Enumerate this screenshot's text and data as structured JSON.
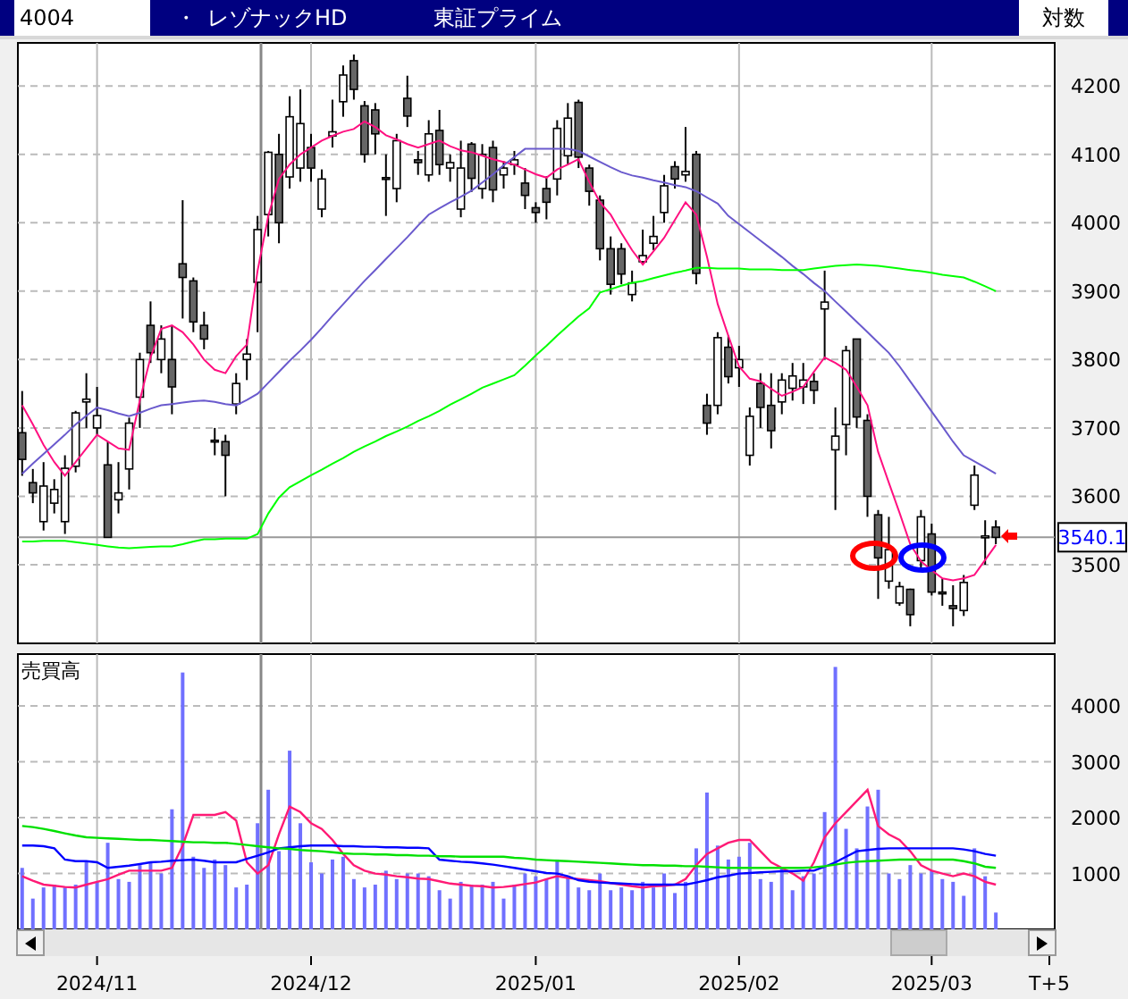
{
  "header": {
    "code": "4004",
    "bullet": "・",
    "name": "レゾナックHD",
    "market": "東証プライム",
    "scale": "対数"
  },
  "price_chart": {
    "markers": [
      {
        "kind": "cursor"
      },
      {
        "kind": "ellipse",
        "color": "#ff0000"
      },
      {
        "kind": "ellipse",
        "color": "#0000ff"
      },
      {
        "kind": "arrow",
        "color": "#ff0000"
      }
    ],
    "chart_data": {
      "type": "candlestick",
      "grid": true,
      "categories": [
        null,
        null,
        null,
        null,
        null,
        null,
        null,
        null,
        null,
        null,
        null,
        null,
        null,
        null,
        null,
        null,
        null,
        null,
        null,
        null,
        null,
        null,
        null,
        null,
        null,
        null,
        null,
        null,
        null,
        null,
        null,
        null,
        null,
        null,
        null,
        null,
        null,
        null,
        null,
        null,
        null,
        null,
        null,
        null,
        null,
        null,
        null,
        null,
        null,
        null,
        null,
        null,
        null,
        null,
        null,
        null,
        null,
        null,
        null,
        null,
        null,
        null,
        null,
        null,
        null,
        null,
        null,
        null,
        null,
        null,
        null,
        null,
        null,
        null,
        null,
        null,
        null,
        null,
        null,
        null,
        null,
        null,
        null,
        null,
        null,
        null,
        null,
        null,
        null,
        null,
        null,
        null,
        null,
        null,
        null,
        null,
        null
      ],
      "ylim": [
        3385,
        4263
      ],
      "yticks": [
        3500,
        3600,
        3700,
        3800,
        3900,
        4000,
        4100,
        4200
      ],
      "ref_lines": [
        {
          "axis": "y",
          "value": 3540.1,
          "label": "3540.1"
        }
      ],
      "ohlc": [
        [
          3693,
          3754,
          3630,
          3654
        ],
        [
          3620,
          3640,
          3590,
          3605
        ],
        [
          3563,
          3650,
          3550,
          3615
        ],
        [
          3590,
          3625,
          3575,
          3610
        ],
        [
          3563,
          3660,
          3545,
          3641
        ],
        [
          3644,
          3725,
          3635,
          3722
        ],
        [
          3738,
          3780,
          3700,
          3742
        ],
        [
          3700,
          3760,
          3690,
          3718
        ],
        [
          3646,
          3680,
          3540,
          3540
        ],
        [
          3595,
          3650,
          3575,
          3605
        ],
        [
          3640,
          3715,
          3610,
          3707
        ],
        [
          3745,
          3810,
          3700,
          3800
        ],
        [
          3850,
          3885,
          3795,
          3810
        ],
        [
          3800,
          3850,
          3780,
          3830
        ],
        [
          3800,
          3850,
          3720,
          3760
        ],
        [
          3940,
          4033,
          3860,
          3920
        ],
        [
          3915,
          3920,
          3840,
          3855
        ],
        [
          3850,
          3870,
          3815,
          3830
        ],
        [
          3682,
          3700,
          3660,
          3680
        ],
        [
          3680,
          3690,
          3600,
          3660
        ],
        [
          3735,
          3780,
          3720,
          3765
        ],
        [
          3800,
          3830,
          3770,
          3808
        ],
        [
          3913,
          4010,
          3840,
          3990
        ],
        [
          4012,
          4105,
          3980,
          4103
        ],
        [
          4100,
          4130,
          3970,
          4000
        ],
        [
          4067,
          4185,
          4050,
          4155
        ],
        [
          4080,
          4195,
          4060,
          4145
        ],
        [
          4110,
          4130,
          4060,
          4080
        ],
        [
          4020,
          4078,
          4008,
          4064
        ],
        [
          4127,
          4180,
          4110,
          4133
        ],
        [
          4177,
          4230,
          4155,
          4216
        ],
        [
          4237,
          4246,
          4180,
          4195
        ],
        [
          4171,
          4178,
          4088,
          4100
        ],
        [
          4165,
          4175,
          4100,
          4130
        ],
        [
          4066,
          4100,
          4010,
          4064
        ],
        [
          4050,
          4130,
          4030,
          4120
        ],
        [
          4182,
          4215,
          4140,
          4156
        ],
        [
          4092,
          4105,
          4070,
          4088
        ],
        [
          4070,
          4150,
          4060,
          4130
        ],
        [
          4135,
          4165,
          4070,
          4085
        ],
        [
          4080,
          4100,
          4060,
          4088
        ],
        [
          4020,
          4120,
          4008,
          4080
        ],
        [
          4115,
          4118,
          4045,
          4065
        ],
        [
          4050,
          4115,
          4035,
          4100
        ],
        [
          4110,
          4120,
          4030,
          4048
        ],
        [
          4070,
          4090,
          4050,
          4080
        ],
        [
          4085,
          4105,
          4070,
          4092
        ],
        [
          4058,
          4080,
          4020,
          4040
        ],
        [
          4022,
          4030,
          4000,
          4015
        ],
        [
          4050,
          4068,
          4005,
          4030
        ],
        [
          4064,
          4150,
          4040,
          4138
        ],
        [
          4098,
          4175,
          4085,
          4153
        ],
        [
          4176,
          4180,
          4080,
          4096
        ],
        [
          4080,
          4085,
          4025,
          4046
        ],
        [
          4033,
          4040,
          3945,
          3962
        ],
        [
          3962,
          3980,
          3895,
          3910
        ],
        [
          3962,
          3970,
          3910,
          3925
        ],
        [
          3895,
          3930,
          3885,
          3912
        ],
        [
          3943,
          3990,
          3940,
          3952
        ],
        [
          3970,
          4010,
          3960,
          3980
        ],
        [
          4015,
          4070,
          4000,
          4054
        ],
        [
          4082,
          4090,
          4050,
          4064
        ],
        [
          4070,
          4140,
          4060,
          4075
        ],
        [
          4100,
          4105,
          3910,
          3926
        ],
        [
          3733,
          3750,
          3690,
          3707
        ],
        [
          3733,
          3840,
          3720,
          3832
        ],
        [
          3818,
          3835,
          3765,
          3775
        ],
        [
          3788,
          3820,
          3760,
          3800
        ],
        [
          3660,
          3730,
          3645,
          3717
        ],
        [
          3765,
          3780,
          3700,
          3730
        ],
        [
          3733,
          3780,
          3670,
          3696
        ],
        [
          3738,
          3780,
          3720,
          3770
        ],
        [
          3758,
          3795,
          3740,
          3776
        ],
        [
          3760,
          3795,
          3735,
          3770
        ],
        [
          3768,
          3780,
          3735,
          3755
        ],
        [
          3874,
          3930,
          3800,
          3884
        ],
        [
          3668,
          3730,
          3580,
          3688
        ],
        [
          3705,
          3820,
          3660,
          3813
        ],
        [
          3830,
          3830,
          3700,
          3716
        ],
        [
          3711,
          3720,
          3570,
          3600
        ],
        [
          3573,
          3580,
          3450,
          3510
        ],
        [
          3476,
          3570,
          3465,
          3522
        ],
        [
          3444,
          3475,
          3440,
          3468
        ],
        [
          3464,
          3465,
          3410,
          3427
        ],
        [
          3506,
          3580,
          3495,
          3570
        ],
        [
          3545,
          3560,
          3455,
          3460
        ],
        [
          3460,
          3480,
          3440,
          3458
        ],
        [
          3440,
          3470,
          3410,
          3436
        ],
        [
          3433,
          3485,
          3425,
          3474
        ],
        [
          3587,
          3645,
          3580,
          3631
        ],
        [
          3540,
          3565,
          3500,
          3542
        ],
        [
          3555,
          3565,
          3530,
          3540
        ],
        null,
        null,
        null,
        null,
        null
      ],
      "series": [
        {
          "type": "line",
          "color": "#ff1080",
          "values": [
            3733,
            3705,
            3675,
            3650,
            3630,
            3650,
            3670,
            3690,
            3680,
            3670,
            3668,
            3740,
            3803,
            3845,
            3850,
            3840,
            3822,
            3800,
            3785,
            3780,
            3805,
            3822,
            3930,
            4010,
            4064,
            4085,
            4100,
            4110,
            4120,
            4127,
            4133,
            4137,
            4148,
            4140,
            4128,
            4122,
            4115,
            4110,
            4115,
            4120,
            4112,
            4106,
            4103,
            4098,
            4093,
            4089,
            4085,
            4078,
            4071,
            4066,
            4078,
            4085,
            4093,
            4060,
            4030,
            4012,
            3985,
            3960,
            3939,
            3958,
            3978,
            4004,
            4030,
            4012,
            3950,
            3881,
            3835,
            3790,
            3772,
            3768,
            3757,
            3747,
            3753,
            3760,
            3782,
            3803,
            3795,
            3785,
            3760,
            3733,
            3665,
            3620,
            3576,
            3530,
            3505,
            3492,
            3480,
            3477,
            3480,
            3485,
            3507,
            3529,
            null,
            null,
            null,
            null,
            null
          ]
        },
        {
          "type": "line",
          "color": "#6a5acd",
          "values": [
            3633,
            3648,
            3662,
            3676,
            3690,
            3705,
            3718,
            3730,
            3726,
            3721,
            3717,
            3722,
            3728,
            3733,
            3735,
            3737,
            3739,
            3740,
            3738,
            3735,
            3733,
            3741,
            3750,
            3766,
            3782,
            3798,
            3813,
            3829,
            3846,
            3864,
            3881,
            3898,
            3915,
            3931,
            3947,
            3963,
            3979,
            3996,
            4012,
            4021,
            4030,
            4038,
            4047,
            4059,
            4071,
            4084,
            4096,
            4108,
            4108,
            4108,
            4108,
            4108,
            4105,
            4097,
            4089,
            4081,
            4074,
            4069,
            4066,
            4062,
            4059,
            4055,
            4052,
            4046,
            4037,
            4028,
            4010,
            3998,
            3986,
            3974,
            3962,
            3950,
            3937,
            3925,
            3912,
            3900,
            3885,
            3870,
            3855,
            3840,
            3825,
            3810,
            3790,
            3768,
            3746,
            3724,
            3702,
            3680,
            3660,
            3651,
            3642,
            3633,
            null,
            null,
            null,
            null,
            null
          ]
        },
        {
          "type": "line",
          "color": "#00ff00",
          "values": [
            3534,
            3534,
            3535,
            3535,
            3535,
            3533,
            3531,
            3529,
            3527,
            3525,
            3524,
            3525,
            3526,
            3527,
            3527,
            3530,
            3534,
            3537,
            3537,
            3538,
            3538,
            3538,
            3545,
            3575,
            3598,
            3613,
            3622,
            3631,
            3639,
            3648,
            3656,
            3665,
            3673,
            3680,
            3688,
            3695,
            3702,
            3710,
            3717,
            3725,
            3734,
            3742,
            3750,
            3759,
            3765,
            3771,
            3777,
            3791,
            3806,
            3820,
            3835,
            3849,
            3863,
            3875,
            3898,
            3903,
            3908,
            3912,
            3915,
            3919,
            3923,
            3927,
            3930,
            3934,
            3934,
            3933,
            3933,
            3933,
            3932,
            3932,
            3932,
            3931,
            3931,
            3931,
            3933,
            3935,
            3937,
            3938,
            3939,
            3938,
            3937,
            3935,
            3933,
            3931,
            3929,
            3927,
            3924,
            3922,
            3920,
            3914,
            3907,
            3900,
            null,
            null,
            null,
            null,
            null
          ]
        }
      ]
    }
  },
  "volume_chart": {
    "markers": [
      {
        "kind": "cursor"
      }
    ],
    "chart_data": {
      "type": "bar",
      "title": "売買高",
      "grid": true,
      "categories": [
        null,
        null,
        null,
        null,
        null,
        null,
        null,
        "2024/11",
        null,
        null,
        null,
        null,
        null,
        null,
        null,
        null,
        null,
        null,
        null,
        null,
        null,
        null,
        null,
        null,
        null,
        null,
        null,
        "2024/12",
        null,
        null,
        null,
        null,
        null,
        null,
        null,
        null,
        null,
        null,
        null,
        null,
        null,
        null,
        null,
        null,
        null,
        null,
        null,
        null,
        "2025/01",
        null,
        null,
        null,
        null,
        null,
        null,
        null,
        null,
        null,
        null,
        null,
        null,
        null,
        null,
        null,
        null,
        null,
        null,
        "2025/02",
        null,
        null,
        null,
        null,
        null,
        null,
        null,
        null,
        null,
        null,
        null,
        null,
        null,
        null,
        null,
        null,
        null,
        "2025/03",
        null,
        null,
        null,
        null,
        null,
        null,
        null,
        null,
        null,
        null,
        "T+5"
      ],
      "ylim": [
        0,
        4930
      ],
      "yticks": [
        1000,
        2000,
        3000,
        4000
      ],
      "series": [
        {
          "type": "bar",
          "color": "#7070ff",
          "values": [
            1100,
            550,
            750,
            800,
            750,
            800,
            1200,
            850,
            1550,
            900,
            850,
            1150,
            1200,
            1000,
            2150,
            4600,
            1300,
            1100,
            1250,
            1150,
            750,
            800,
            1900,
            2500,
            1400,
            3200,
            1900,
            1200,
            1000,
            1250,
            1300,
            900,
            750,
            800,
            1050,
            900,
            1000,
            1000,
            950,
            700,
            550,
            850,
            800,
            800,
            850,
            550,
            800,
            1000,
            950,
            900,
            1250,
            950,
            750,
            700,
            1000,
            700,
            750,
            700,
            850,
            750,
            1000,
            650,
            850,
            1450,
            2450,
            1500,
            1250,
            1300,
            1550,
            900,
            850,
            1100,
            700,
            950,
            1000,
            2100,
            4700,
            1800,
            1450,
            2200,
            2500,
            1000,
            900,
            1150,
            1000,
            1050,
            900,
            850,
            600,
            1450,
            950,
            300,
            null,
            null,
            null,
            null,
            null
          ]
        },
        {
          "type": "line",
          "color": "#ff1a75",
          "values": [
            950,
            870,
            800,
            780,
            760,
            750,
            800,
            850,
            900,
            980,
            1050,
            1050,
            1050,
            1050,
            1100,
            1500,
            2050,
            2050,
            2050,
            2100,
            1950,
            1200,
            1000,
            1150,
            1700,
            2200,
            2100,
            1900,
            1800,
            1600,
            1350,
            1150,
            1050,
            1000,
            980,
            950,
            930,
            910,
            900,
            860,
            820,
            800,
            780,
            770,
            750,
            760,
            780,
            810,
            840,
            900,
            950,
            920,
            900,
            880,
            860,
            830,
            800,
            770,
            750,
            770,
            780,
            800,
            900,
            1150,
            1350,
            1450,
            1550,
            1600,
            1600,
            1400,
            1200,
            1100,
            1000,
            870,
            1200,
            1650,
            1900,
            2100,
            2300,
            2500,
            1850,
            1700,
            1600,
            1400,
            1150,
            1050,
            1000,
            950,
            1000,
            950,
            850,
            800,
            null,
            null,
            null,
            null,
            null
          ]
        },
        {
          "type": "line",
          "color": "#0000ff",
          "values": [
            1500,
            1500,
            1490,
            1450,
            1250,
            1220,
            1220,
            1200,
            1100,
            1120,
            1140,
            1170,
            1200,
            1210,
            1230,
            1240,
            1250,
            1230,
            1200,
            1200,
            1200,
            1260,
            1320,
            1380,
            1450,
            1470,
            1490,
            1500,
            1500,
            1500,
            1490,
            1490,
            1480,
            1480,
            1470,
            1470,
            1460,
            1460,
            1450,
            1250,
            1230,
            1210,
            1200,
            1180,
            1160,
            1130,
            1100,
            1070,
            1040,
            1010,
            1000,
            950,
            880,
            850,
            840,
            830,
            820,
            810,
            800,
            800,
            800,
            800,
            800,
            840,
            880,
            930,
            960,
            1000,
            1010,
            1020,
            1030,
            1040,
            1040,
            1050,
            1050,
            1120,
            1200,
            1300,
            1400,
            1420,
            1440,
            1450,
            1450,
            1450,
            1450,
            1450,
            1450,
            1450,
            1430,
            1400,
            1350,
            1320,
            null,
            null,
            null,
            null,
            null
          ]
        },
        {
          "type": "line",
          "color": "#00e000",
          "values": [
            1850,
            1830,
            1800,
            1760,
            1720,
            1680,
            1650,
            1640,
            1630,
            1620,
            1610,
            1600,
            1600,
            1590,
            1580,
            1570,
            1560,
            1560,
            1550,
            1550,
            1530,
            1510,
            1490,
            1470,
            1450,
            1440,
            1420,
            1410,
            1400,
            1380,
            1360,
            1350,
            1350,
            1340,
            1340,
            1330,
            1330,
            1320,
            1320,
            1310,
            1310,
            1300,
            1300,
            1300,
            1300,
            1300,
            1280,
            1270,
            1250,
            1240,
            1230,
            1220,
            1210,
            1200,
            1190,
            1180,
            1170,
            1160,
            1150,
            1150,
            1140,
            1140,
            1130,
            1130,
            1120,
            1110,
            1100,
            1100,
            1100,
            1100,
            1100,
            1100,
            1100,
            1100,
            1110,
            1130,
            1160,
            1190,
            1210,
            1220,
            1230,
            1240,
            1250,
            1250,
            1250,
            1250,
            1250,
            1250,
            1220,
            1180,
            1120,
            1100,
            null,
            null,
            null,
            null,
            null
          ]
        }
      ]
    }
  }
}
